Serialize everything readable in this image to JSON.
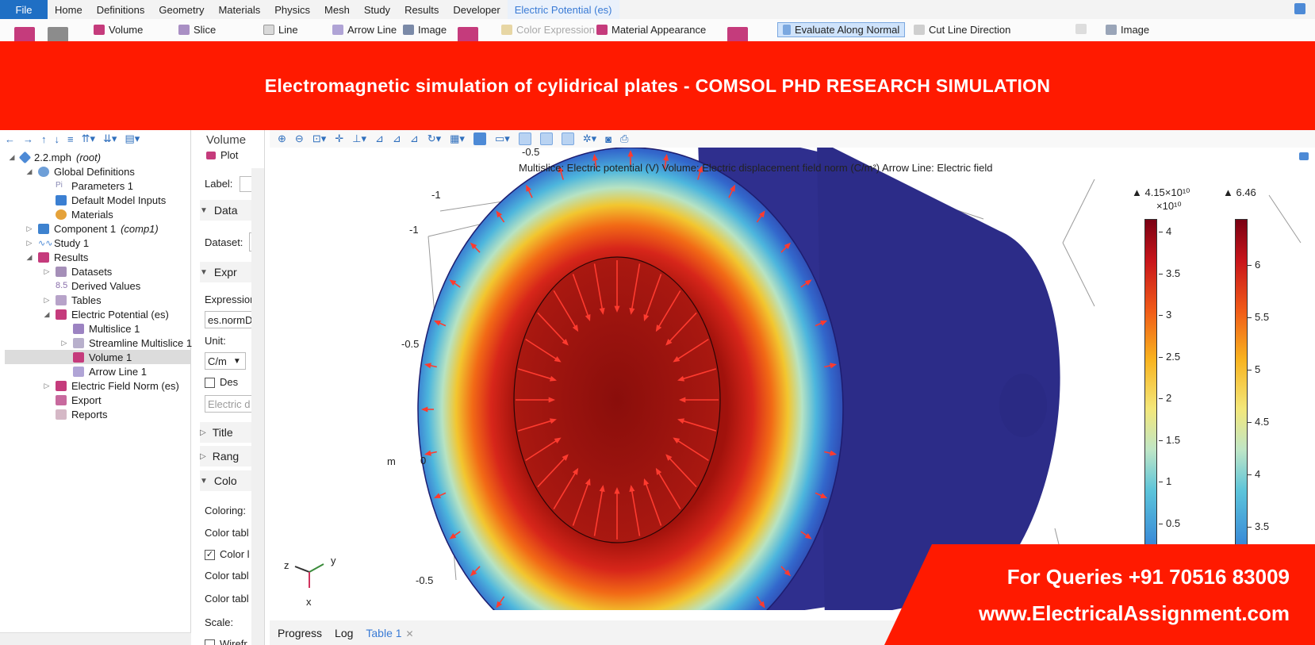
{
  "menu": {
    "file": "File",
    "tabs": [
      "Home",
      "Definitions",
      "Geometry",
      "Materials",
      "Physics",
      "Mesh",
      "Study",
      "Results",
      "Developer"
    ],
    "context_tab": "Electric Potential (es)"
  },
  "ribbon": {
    "volume": "Volume",
    "slice": "Slice",
    "line": "Line",
    "arrow_line": "Arrow Line",
    "image": "Image",
    "color_expression": "Color Expression",
    "material_appearance": "Material Appearance",
    "evaluate_along_normal": "Evaluate Along Normal",
    "cut_line_direction": "Cut Line Direction",
    "image2": "Image"
  },
  "banner": {
    "title": "Electromagnetic simulation of cylidrical plates - COMSOL PHD RESEARCH SIMULATION"
  },
  "tree": {
    "root": "2.2.mph",
    "root_suffix": "(root)",
    "items": [
      "Global Definitions",
      "Parameters 1",
      "Default Model Inputs",
      "Materials",
      "Component 1",
      "Study 1",
      "Results",
      "Datasets",
      "Derived Values",
      "Tables",
      "Electric Potential (es)",
      "Multislice 1",
      "Streamline Multislice 1",
      "Volume 1",
      "Arrow Line 1",
      "Electric Field Norm (es)",
      "Export",
      "Reports"
    ],
    "component_suffix": "(comp1)"
  },
  "settings": {
    "title": "Volume",
    "plot_button": "Plot",
    "label": "Label:",
    "data_section": "Data",
    "dataset": "Dataset:",
    "expr_section": "Expr",
    "expression": "Expression",
    "expression_value": "es.normD",
    "unit": "Unit:",
    "unit_value": "C/m",
    "description": "Des",
    "description_value": "Electric d",
    "title_section": "Title",
    "range_section": "Rang",
    "coloring_section": "Colo",
    "coloring": "Coloring:",
    "color_table": "Color tabl",
    "color_legend": "Color l",
    "color_table2": "Color tabl",
    "color_table3": "Color tabl",
    "scale": "Scale:",
    "wireframe": "Wirefr"
  },
  "graphics": {
    "plot_title": "Multislice: Electric potential (V)  Volume: Electric displacement field norm (C/m²)  Arrow Line: Electric field",
    "axis_labels": {
      "top": "-0.5",
      "left1": "-1",
      "left2": "-1",
      "mid": "-0.5",
      "zero": "0",
      "unit": "m",
      "bottom": "-0.5"
    },
    "triad": {
      "x": "x",
      "y": "y",
      "z": "z"
    }
  },
  "legends": [
    {
      "max_label": "▲ 4.15×10¹⁰",
      "multiplier": "×10¹⁰",
      "ticks": [
        "4",
        "3.5",
        "3",
        "2.5",
        "2",
        "1.5",
        "1",
        "0.5"
      ],
      "max_value": 4.15,
      "unit_scale": "1e10"
    },
    {
      "max_label": "▲ 6.46",
      "ticks": [
        "6",
        "5.5",
        "5",
        "4.5",
        "4",
        "3.5"
      ],
      "max_value": 6.46
    }
  ],
  "bottom_tabs": {
    "progress": "Progress",
    "log": "Log",
    "table": "Table 1"
  },
  "contact": {
    "phone": "For Queries +91 70516 83009",
    "website": "www.ElectricalAssignment.com"
  },
  "colors": {
    "banner_red": "#ff1a00",
    "file_blue": "#1f6fc4",
    "accent_blue": "#3a7bd5"
  }
}
